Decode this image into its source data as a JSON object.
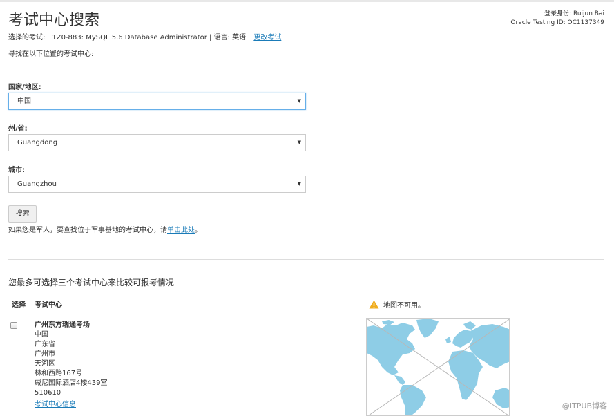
{
  "header": {
    "title": "考试中心搜索",
    "login_line1": "登录身份: Ruijun Bai",
    "login_line2": "Oracle Testing ID: OC1137349"
  },
  "exam": {
    "label": "选择的考试:",
    "value": "1Z0-883: MySQL 5.6 Database Administrator | 语言: 英语",
    "change_link": "更改考试"
  },
  "find_text": "寻找在以下位置的考试中心:",
  "form": {
    "country_label": "国家/地区:",
    "country_value": "中国",
    "state_label": "州/省:",
    "state_value": "Guangdong",
    "city_label": "城市:",
    "city_value": "Guangzhou",
    "search_button": "搜索"
  },
  "military": {
    "prefix": "如果您是军人，要查找位于军事基地的考试中心，请",
    "link": "单击此处",
    "suffix": "。"
  },
  "compare_text": "您最多可选择三个考试中心来比较可报考情况",
  "table": {
    "col_select": "选择",
    "col_center": "考试中心"
  },
  "center": {
    "name": "广州东方瑞通考场",
    "country": "中国",
    "province": "广东省",
    "city": "广州市",
    "district": "天河区",
    "street": "林和西路167号",
    "building": "威尼国际酒店4楼439室",
    "postcode": "510610",
    "info_link": "考试中心信息"
  },
  "map": {
    "unavailable": "地图不可用。",
    "water_color": "#ffffff",
    "land_color": "#8ecde6"
  },
  "watermark": "@ITPUB博客",
  "icons": [
    "warning-icon",
    "caret-down-icon"
  ]
}
